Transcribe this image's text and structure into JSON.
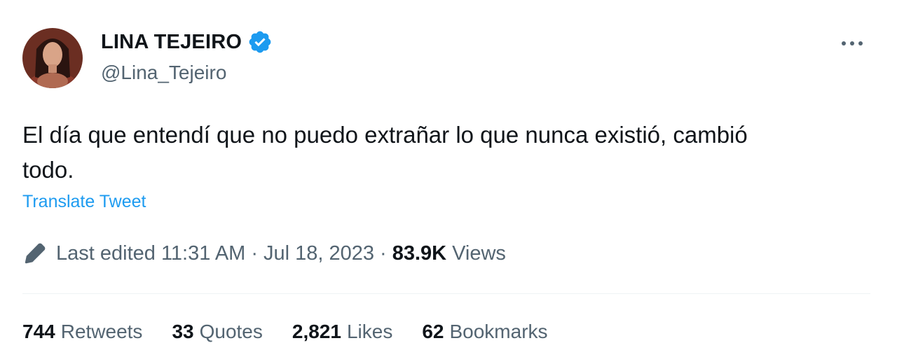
{
  "author": {
    "display_name": "LINA TEJEIRO",
    "handle": "@Lina_Tejeiro",
    "verified": true
  },
  "tweet": {
    "text": "El día que entendí que no puedo extrañar lo que nunca existió, cambió\ntodo.",
    "translate_label": "Translate Tweet"
  },
  "meta": {
    "edited_label": "Last edited",
    "time": "11:31 AM",
    "separator": "·",
    "date": "Jul 18, 2023",
    "views_count": "83.9K",
    "views_label": "Views"
  },
  "stats": {
    "retweets": {
      "count": "744",
      "label": "Retweets"
    },
    "quotes": {
      "count": "33",
      "label": "Quotes"
    },
    "likes": {
      "count": "2,821",
      "label": "Likes"
    },
    "bookmarks": {
      "count": "62",
      "label": "Bookmarks"
    }
  },
  "icons": {
    "verified": "verified-badge-icon",
    "more": "more-options-icon",
    "edit": "edit-pencil-icon"
  },
  "colors": {
    "accent": "#1d9bf0",
    "text_primary": "#0f1419",
    "text_secondary": "#536471",
    "divider": "#eff3f4"
  }
}
